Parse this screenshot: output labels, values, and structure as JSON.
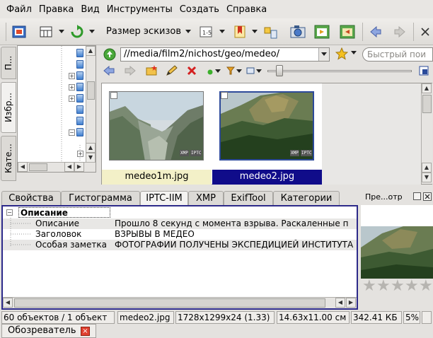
{
  "menu": [
    "Файл",
    "Правка",
    "Вид",
    "Инструменты",
    "Создать",
    "Справка"
  ],
  "toolbar": {
    "thumb_size_label": "Размер эскизов"
  },
  "left_tabs": [
    "П...",
    "Избр...",
    "Кате..."
  ],
  "address": {
    "path": "//media/film2/nichost/geo/medeo/",
    "search_placeholder": "Быстрый пои"
  },
  "thumbnails": [
    {
      "filename": "medeo1m.jpg",
      "selected": false
    },
    {
      "filename": "medeo2.jpg",
      "selected": true
    }
  ],
  "thumb_badges": [
    "XMP",
    "IPTC"
  ],
  "tabs": [
    "Свойства",
    "Гистограмма",
    "IPTC-IIM",
    "XMP",
    "ExifTool",
    "Категории"
  ],
  "active_tab": "IPTC-IIM",
  "preview": {
    "title": "Пре...отр"
  },
  "props": {
    "section": "Описание",
    "rows": [
      {
        "key": "Описание",
        "value": "Прошло 8 секунд с момента взрыва. Раскаленные п"
      },
      {
        "key": "Заголовок",
        "value": "ВЗРЫВЫ В МЕДЕО"
      },
      {
        "key": "Особая заметка",
        "value": "ФОТОГРАФИИ ПОЛУЧЕНЫ ЭКСПЕДИЦИЕЙ ИНСТИТУТА"
      }
    ]
  },
  "status": [
    "60 объектов / 1 объект",
    "medeo2.jpg",
    "1728x1299x24 (1.33)",
    "14.63x11.00 см",
    "342.41 КБ",
    "5%"
  ],
  "bottom_tab": "Обозреватель",
  "colors": {
    "selection": "#100c8a",
    "accent_border": "#2d2a8a",
    "highlight_caption": "#f3f0c8"
  }
}
